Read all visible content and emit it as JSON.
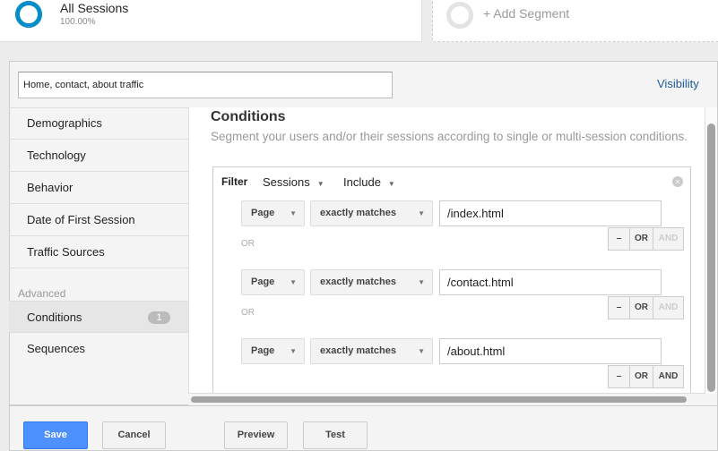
{
  "segments": {
    "active": {
      "name": "All Sessions",
      "percent": "100.00%",
      "color": "#058dc7"
    },
    "add_label": "+ Add Segment"
  },
  "editor": {
    "name_value": "Home, contact, about traffic",
    "visibility": "Visibility"
  },
  "sidebar": {
    "items": [
      "Demographics",
      "Technology",
      "Behavior",
      "Date of First Session",
      "Traffic Sources"
    ],
    "advanced_label": "Advanced",
    "advanced_items": [
      {
        "label": "Conditions",
        "badge": "1",
        "selected": true
      },
      {
        "label": "Sequences"
      }
    ]
  },
  "main": {
    "title": "Conditions",
    "subtitle": "Segment your users and/or their sessions according to single or multi-session conditions.",
    "filter": {
      "label": "Filter",
      "scope": "Sessions",
      "mode": "Include",
      "or_label": "OR",
      "rows": [
        {
          "dimension": "Page",
          "operator": "exactly matches",
          "value": "/index.html",
          "and_enabled": false
        },
        {
          "dimension": "Page",
          "operator": "exactly matches",
          "value": "/contact.html",
          "and_enabled": false
        },
        {
          "dimension": "Page",
          "operator": "exactly matches",
          "value": "/about.html",
          "and_enabled": true
        }
      ],
      "remove": "–",
      "or": "OR",
      "and": "AND"
    }
  },
  "footer": {
    "save": "Save",
    "cancel": "Cancel",
    "preview": "Preview",
    "test": "Test"
  },
  "colors": {
    "accent": "#4d90fe",
    "link": "#1c5a9c"
  }
}
